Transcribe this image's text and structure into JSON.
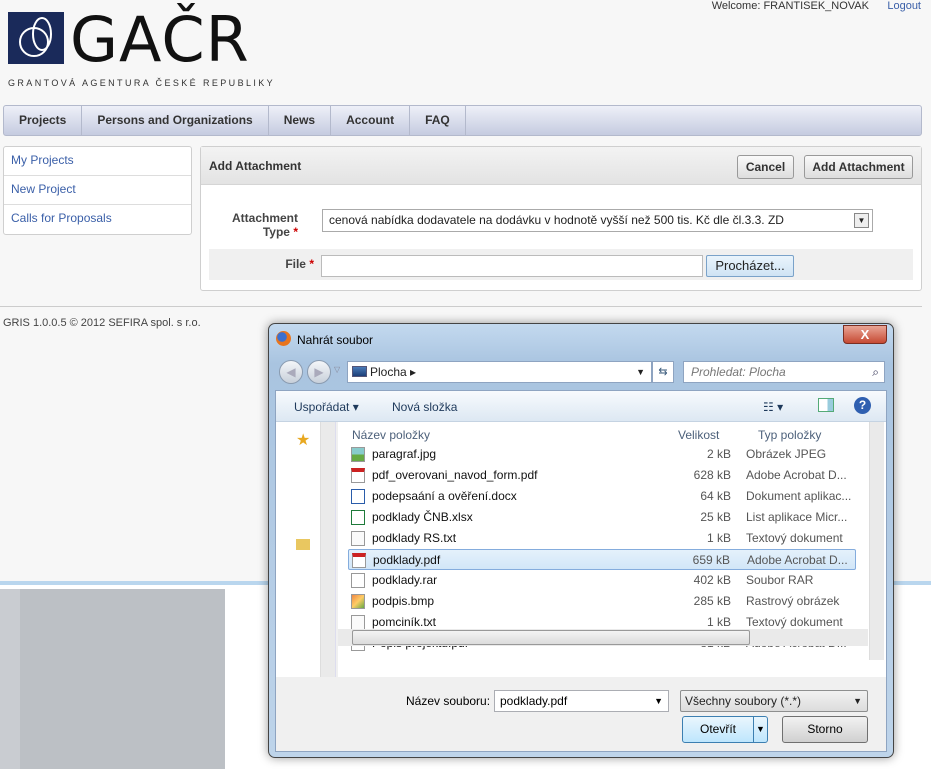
{
  "header": {
    "logo_text": "GAČR",
    "logo_subtitle": "GRANTOVÁ AGENTURA ČESKÉ REPUBLIKY",
    "welcome": "Welcome: FRANTISEK_NOVAK",
    "logout": "Logout"
  },
  "nav": [
    "Projects",
    "Persons and Organizations",
    "News",
    "Account",
    "FAQ"
  ],
  "sidebar": [
    "My Projects",
    "New Project",
    "Calls for Proposals"
  ],
  "panel": {
    "title": "Add Attachment",
    "cancel": "Cancel",
    "add": "Add Attachment",
    "type_label": "Attachment Type",
    "type_value": "cenová nabídka dodavatele na dodávku v hodnotě vyšší než 500 tis. Kč dle čl.3.3. ZD",
    "file_label": "File",
    "required": "*",
    "browse": "Procházet..."
  },
  "footer": "GRIS 1.0.0.5 © 2012 SEFIRA spol. s r.o.",
  "dialog": {
    "title": "Nahrát soubor",
    "close": "X",
    "location": "Plocha",
    "search_placeholder": "Prohledat: Plocha",
    "organize": "Uspořádat ▾",
    "new_folder": "Nová složka",
    "columns": {
      "name": "Název položky",
      "size": "Velikost",
      "type": "Typ položky"
    },
    "files": [
      {
        "name": "paragraf.jpg",
        "size": "2 kB",
        "type": "Obrázek JPEG",
        "icon": "image"
      },
      {
        "name": "pdf_overovani_navod_form.pdf",
        "size": "628 kB",
        "type": "Adobe Acrobat D...",
        "icon": "pdf"
      },
      {
        "name": "podepsaání a ověření.docx",
        "size": "64 kB",
        "type": "Dokument aplikac...",
        "icon": "word"
      },
      {
        "name": "podklady ČNB.xlsx",
        "size": "25 kB",
        "type": "List aplikace Micr...",
        "icon": "excel"
      },
      {
        "name": "podklady RS.txt",
        "size": "1 kB",
        "type": "Textový dokument",
        "icon": "text"
      },
      {
        "name": "podklady.pdf",
        "size": "659 kB",
        "type": "Adobe Acrobat D...",
        "icon": "pdf",
        "selected": true
      },
      {
        "name": "podklady.rar",
        "size": "402 kB",
        "type": "Soubor RAR",
        "icon": "file"
      },
      {
        "name": "podpis.bmp",
        "size": "285 kB",
        "type": "Rastrový obrázek",
        "icon": "bitmap"
      },
      {
        "name": "pomciník.txt",
        "size": "1 kB",
        "type": "Textový dokument",
        "icon": "text"
      },
      {
        "name": "Popis projektu.pdf",
        "size": "81 kB",
        "type": "Adobe Acrobat D...",
        "icon": "pdf"
      }
    ],
    "filename_label": "Název souboru:",
    "filename": "podklady.pdf",
    "filter": "Všechny soubory (*.*)",
    "open": "Otevřít",
    "cancel": "Storno"
  }
}
